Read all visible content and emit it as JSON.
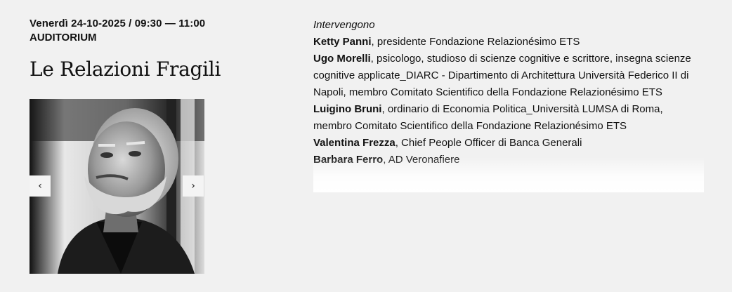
{
  "event": {
    "date_time": "Venerdì 24-10-2025 / 09:30 — 11:00",
    "venue": "AUDITORIUM",
    "title": "Le Relazioni Fragili"
  },
  "carousel": {
    "prev_icon": "chevron-left-icon",
    "prev_glyph": "‹",
    "next_icon": "chevron-right-icon",
    "next_glyph": "›"
  },
  "speakers": {
    "intro": "Intervengono",
    "list": [
      {
        "name": "Ketty Panni",
        "role": ", presidente Fondazione Relazionésimo ETS"
      },
      {
        "name": "Ugo Morelli",
        "role": ", psicologo, studioso di scienze cognitive e scrittore, insegna scienze cognitive applicate_DIARC - Dipartimento di Architettura Università Federico II di Napoli, membro Comitato Scientifico della Fondazione Relazionésimo ETS"
      },
      {
        "name": "Luigino Bruni",
        "role": ", ordinario di Economia Politica_Università LUMSA di Roma, membro Comitato Scientifico della Fondazione Relazionésimo ETS"
      },
      {
        "name": "Valentina Frezza",
        "role": ", Chief People Officer di Banca Generali"
      },
      {
        "name": "Barbara Ferro",
        "role": ", AD Veronafiere"
      }
    ]
  }
}
